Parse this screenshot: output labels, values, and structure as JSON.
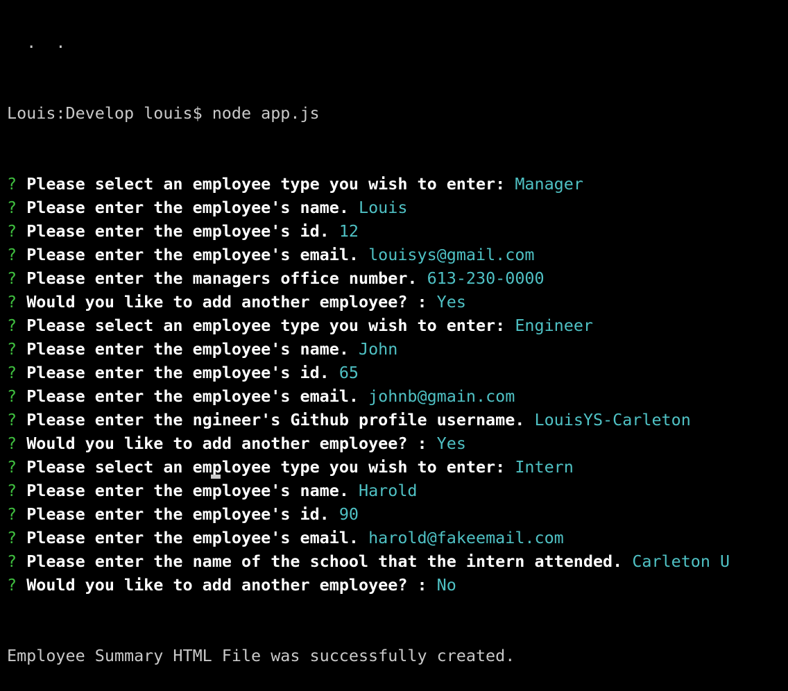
{
  "terminal": {
    "partial_line": "  .  .",
    "command_line": "Louis:Develop louis$ node app.js",
    "prompts": [
      {
        "marker": "?",
        "question": "Please select an employee type you wish to enter:",
        "answer": "Manager"
      },
      {
        "marker": "?",
        "question": "Please enter the employee's name.",
        "answer": "Louis"
      },
      {
        "marker": "?",
        "question": "Please enter the employee's id.",
        "answer": "12"
      },
      {
        "marker": "?",
        "question": "Please enter the employee's email.",
        "answer": "louisys@gmail.com"
      },
      {
        "marker": "?",
        "question": "Please enter the managers office number.",
        "answer": "613-230-0000"
      },
      {
        "marker": "?",
        "question": "Would you like to add another employee? :",
        "answer": "Yes"
      },
      {
        "marker": "?",
        "question": "Please select an employee type you wish to enter:",
        "answer": "Engineer"
      },
      {
        "marker": "?",
        "question": "Please enter the employee's name.",
        "answer": "John"
      },
      {
        "marker": "?",
        "question": "Please enter the employee's id.",
        "answer": "65"
      },
      {
        "marker": "?",
        "question": "Please enter the employee's email.",
        "answer": "johnb@gmain.com"
      },
      {
        "marker": "?",
        "question": "Please enter the ngineer's Github profile username.",
        "answer": "LouisYS-Carleton"
      },
      {
        "marker": "?",
        "question": "Would you like to add another employee? :",
        "answer": "Yes"
      },
      {
        "marker": "?",
        "question": "Please select an employee type you wish to enter:",
        "answer": "Intern"
      },
      {
        "marker": "?",
        "question": "Please enter the employee's name.",
        "answer": "Harold"
      },
      {
        "marker": "?",
        "question": "Please enter the employee's id.",
        "answer": "90"
      },
      {
        "marker": "?",
        "question": "Please enter the employee's email.",
        "answer": "harold@fakeemail.com"
      },
      {
        "marker": "?",
        "question": "Please enter the name of the school that the intern attended.",
        "answer": "Carleton U"
      },
      {
        "marker": "?",
        "question": "Would you like to add another employee? :",
        "answer": "No"
      }
    ],
    "final_output": "Employee Summary HTML File was successfully created."
  }
}
